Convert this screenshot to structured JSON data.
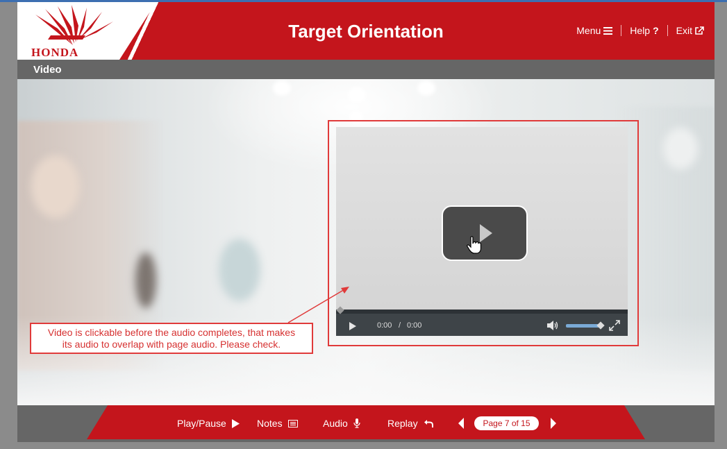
{
  "header": {
    "logo_text": "HONDA",
    "title": "Target Orientation",
    "nav": [
      {
        "label": "Menu",
        "icon": "hamburger-icon"
      },
      {
        "label": "Help",
        "icon": "question-icon"
      },
      {
        "label": "Exit",
        "icon": "external-link-icon"
      }
    ]
  },
  "subbar": {
    "title": "Video"
  },
  "player": {
    "current_time": "0:00",
    "separator": "/",
    "duration": "0:00",
    "volume_percent": 100
  },
  "annotation": {
    "line1": "Video is clickable before the audio completes, that makes",
    "line2": "its audio to overlap with page audio. Please check."
  },
  "footer": {
    "play_pause": "Play/Pause",
    "notes": "Notes",
    "audio": "Audio",
    "replay": "Replay",
    "page_label": "Page 7 of 15"
  },
  "colors": {
    "brand_red": "#c4151c",
    "bar_gray": "#666666",
    "annotation_red": "#e03a3a"
  }
}
